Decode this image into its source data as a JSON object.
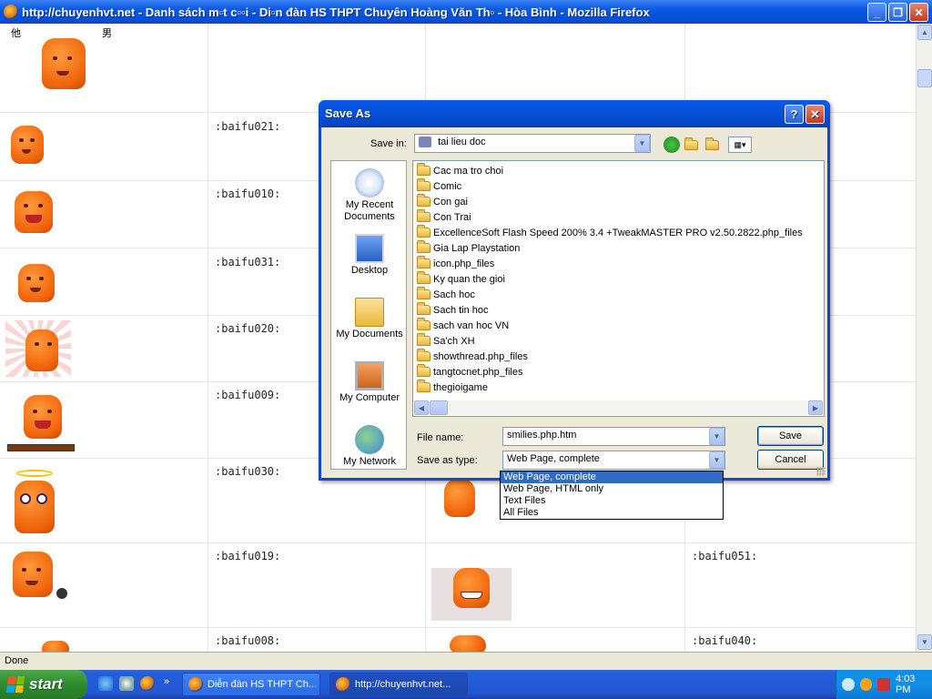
{
  "window": {
    "title": "http://chuyenhvt.net - Danh sách mặt cười - Diễn đàn HS THPT Chuyên Hoàng Văn Thụ - Hòa Bình - Mozilla Firefox",
    "title_display": "http://chuyenhvt.net - Danh sách m▫t c▫▫i - Di▫n đàn HS THPT Chuyên Hoàng Văn Th▫ - Hòa Bình - Mozilla Firefox"
  },
  "page": {
    "smiley_codes": [
      ":baifu021:",
      ":baifu010:",
      ":baifu031:",
      ":baifu020:",
      ":baifu009:",
      ":baifu030:",
      ":baifu019:",
      ":baifu008:"
    ],
    "right_codes": [
      ":baifu051:",
      ":baifu040:"
    ],
    "top_sign_left": "他",
    "top_sign_right": "男"
  },
  "dialog": {
    "title": "Save As",
    "help_label": "?",
    "close_label": "✕",
    "save_in_label": "Save in:",
    "save_in_value": "tai lieu doc",
    "places": [
      "My Recent Documents",
      "Desktop",
      "My Documents",
      "My Computer",
      "My Network"
    ],
    "folders": [
      "Cac ma tro choi",
      "Comic",
      "Con gai",
      "Con Trai",
      "ExcellenceSoft Flash Speed 200% 3.4 +TweakMASTER PRO v2.50.2822.php_files",
      "Gia Lap Playstation",
      "icon.php_files",
      "Ky quan the gioi",
      "Sach hoc",
      "Sach tin hoc",
      "sach van hoc VN",
      "Sa'ch XH",
      "showthread.php_files",
      "tangtocnet.php_files",
      "thegioigame"
    ],
    "file_name_label": "File name:",
    "file_name_value": "smilies.php.htm",
    "save_as_type_label": "Save as type:",
    "save_as_type_value": "Web Page, complete",
    "type_options": [
      "Web Page, complete",
      "Web Page, HTML only",
      "Text Files",
      "All Files"
    ],
    "save_button": "Save",
    "cancel_button": "Cancel"
  },
  "statusbar": {
    "text": "Done"
  },
  "taskbar": {
    "start_label": "start",
    "windows": [
      "Diễn đàn HS THPT Ch...",
      "http://chuyenhvt.net..."
    ],
    "clock": "4:03 PM"
  },
  "colors": {
    "titlebar_blue": "#0a58e4",
    "dialog_face": "#ece9d8",
    "selection": "#316ac5",
    "smiley_orange": "#f0640a"
  }
}
